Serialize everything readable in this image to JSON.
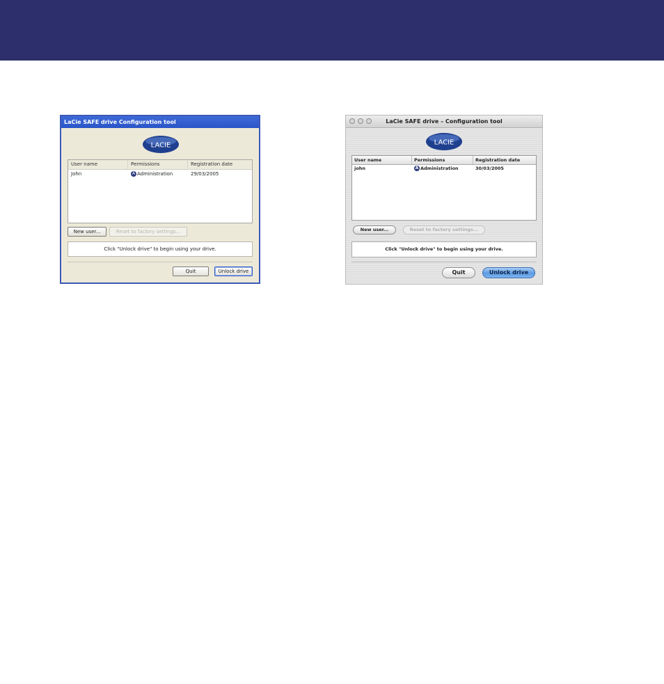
{
  "windows_dialog": {
    "title": "LaCie SAFE drive   Configuration tool",
    "logo_text": "LACIE",
    "columns": [
      "User name",
      "Permissions",
      "Registration date"
    ],
    "rows": [
      {
        "user": "John",
        "permission_icon": "A",
        "permission": "Administration",
        "date": "29/03/2005"
      }
    ],
    "new_user_label": "New user...",
    "reset_label": "Reset to factory settings...",
    "message": "Click \"Unlock drive\" to begin using your drive.",
    "quit_label": "Quit",
    "unlock_label": "Unlock drive"
  },
  "mac_dialog": {
    "title": "LaCie SAFE drive – Configuration tool",
    "logo_text": "LACIE",
    "columns": [
      "User name",
      "Permissions",
      "Registration date"
    ],
    "rows": [
      {
        "user": "john",
        "permission_icon": "A",
        "permission": "Administration",
        "date": "30/03/2005"
      }
    ],
    "new_user_label": "New user...",
    "reset_label": "Reset to factory settings...",
    "message": "Click \"Unlock drive\" to begin using your drive.",
    "quit_label": "Quit",
    "unlock_label": "Unlock drive"
  },
  "colors": {
    "banner": "#2c2f6b",
    "lacie_blue": "#1f3f8f"
  }
}
